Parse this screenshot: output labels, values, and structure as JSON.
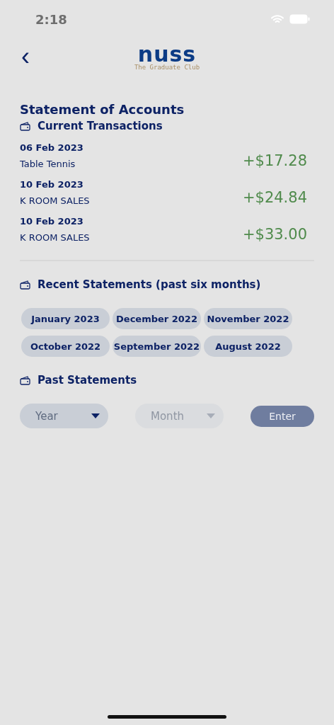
{
  "status_bar": {
    "time": "2:18"
  },
  "header": {
    "back": "‹",
    "logo": {
      "wordmark": "nuss",
      "tagline": "The Graduate Club"
    }
  },
  "title": "Statement of Accounts",
  "current": {
    "heading": "Current Transactions",
    "transactions": [
      {
        "date": "06 Feb 2023",
        "description": "Table Tennis",
        "amount": "+$17.28"
      },
      {
        "date": "10 Feb 2023",
        "description": "K ROOM SALES",
        "amount": "+$24.84"
      },
      {
        "date": "10 Feb 2023",
        "description": "K ROOM SALES",
        "amount": "+$33.00"
      }
    ]
  },
  "recent": {
    "heading": "Recent Statements (past six months)",
    "months": [
      "January 2023",
      "December 2022",
      "November 2022",
      "October 2022",
      "September 2022",
      "August 2022"
    ]
  },
  "past": {
    "heading": "Past Statements",
    "year": {
      "placeholder": "Year",
      "disabled": false
    },
    "month": {
      "placeholder": "Month",
      "disabled": true
    },
    "button": "Enter"
  }
}
